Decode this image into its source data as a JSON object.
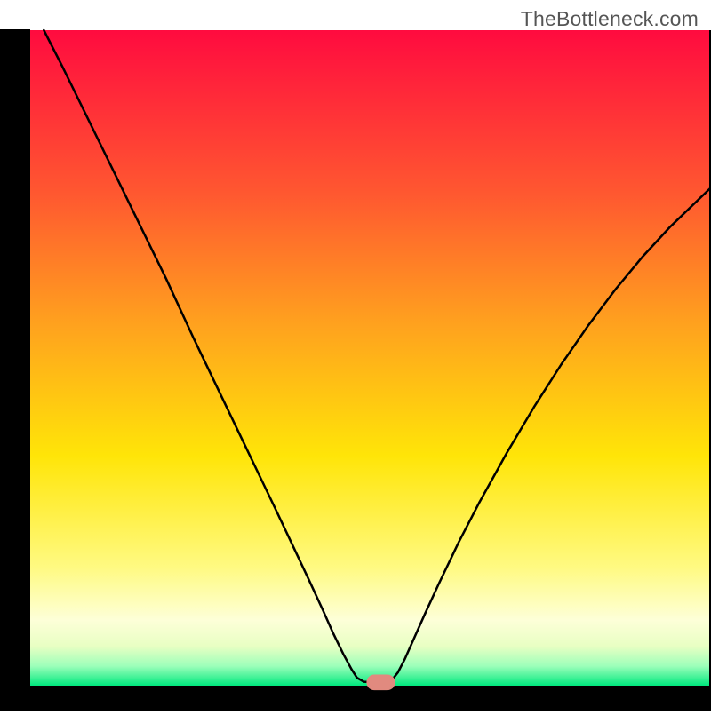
{
  "attribution": "TheBottleneck.com",
  "chart_data": {
    "type": "line",
    "title": "",
    "xlabel": "",
    "ylabel": "",
    "xlim": [
      0,
      100
    ],
    "ylim": [
      0,
      100
    ],
    "frame": {
      "left_border": true,
      "right_border": true,
      "top_border": false,
      "bottom_border": true
    },
    "background_gradient": {
      "axis": "vertical",
      "stops": [
        {
          "t": 0.0,
          "color": "#ff0b3f"
        },
        {
          "t": 0.25,
          "color": "#ff5830"
        },
        {
          "t": 0.45,
          "color": "#ffa21e"
        },
        {
          "t": 0.65,
          "color": "#ffe508"
        },
        {
          "t": 0.82,
          "color": "#fffa82"
        },
        {
          "t": 0.9,
          "color": "#fdffd8"
        },
        {
          "t": 0.94,
          "color": "#e8ffc3"
        },
        {
          "t": 0.97,
          "color": "#9dffba"
        },
        {
          "t": 1.0,
          "color": "#00e97e"
        }
      ]
    },
    "series": [
      {
        "name": "bottleneck-curve",
        "color": "#000000",
        "width": 2.5,
        "points": [
          {
            "x": 2.0,
            "y": 100.0
          },
          {
            "x": 4.7,
            "y": 94.5
          },
          {
            "x": 8.0,
            "y": 87.5
          },
          {
            "x": 12.0,
            "y": 79.0
          },
          {
            "x": 16.0,
            "y": 70.5
          },
          {
            "x": 20.0,
            "y": 62.0
          },
          {
            "x": 24.0,
            "y": 53.0
          },
          {
            "x": 27.0,
            "y": 46.5
          },
          {
            "x": 30.0,
            "y": 40.0
          },
          {
            "x": 33.0,
            "y": 33.5
          },
          {
            "x": 36.0,
            "y": 27.0
          },
          {
            "x": 38.5,
            "y": 21.5
          },
          {
            "x": 41.0,
            "y": 16.0
          },
          {
            "x": 43.0,
            "y": 11.5
          },
          {
            "x": 44.5,
            "y": 8.0
          },
          {
            "x": 46.0,
            "y": 4.8
          },
          {
            "x": 47.2,
            "y": 2.5
          },
          {
            "x": 48.0,
            "y": 1.2
          },
          {
            "x": 49.0,
            "y": 0.6
          },
          {
            "x": 50.5,
            "y": 0.5
          },
          {
            "x": 52.0,
            "y": 0.5
          },
          {
            "x": 53.0,
            "y": 0.7
          },
          {
            "x": 54.0,
            "y": 2.0
          },
          {
            "x": 55.0,
            "y": 4.0
          },
          {
            "x": 56.5,
            "y": 7.5
          },
          {
            "x": 58.0,
            "y": 11.0
          },
          {
            "x": 60.0,
            "y": 15.5
          },
          {
            "x": 63.0,
            "y": 22.0
          },
          {
            "x": 66.0,
            "y": 28.0
          },
          {
            "x": 70.0,
            "y": 35.5
          },
          {
            "x": 74.0,
            "y": 42.5
          },
          {
            "x": 78.0,
            "y": 49.0
          },
          {
            "x": 82.0,
            "y": 55.0
          },
          {
            "x": 86.0,
            "y": 60.5
          },
          {
            "x": 90.0,
            "y": 65.5
          },
          {
            "x": 94.0,
            "y": 70.0
          },
          {
            "x": 98.0,
            "y": 74.0
          },
          {
            "x": 100.0,
            "y": 76.0
          }
        ]
      }
    ],
    "marker": {
      "shape": "rounded-rect",
      "x": 51.5,
      "y": 0.5,
      "width": 4.2,
      "height": 2.4,
      "rx": 1.2,
      "fill": "#e18a7f",
      "stroke": "none"
    }
  }
}
